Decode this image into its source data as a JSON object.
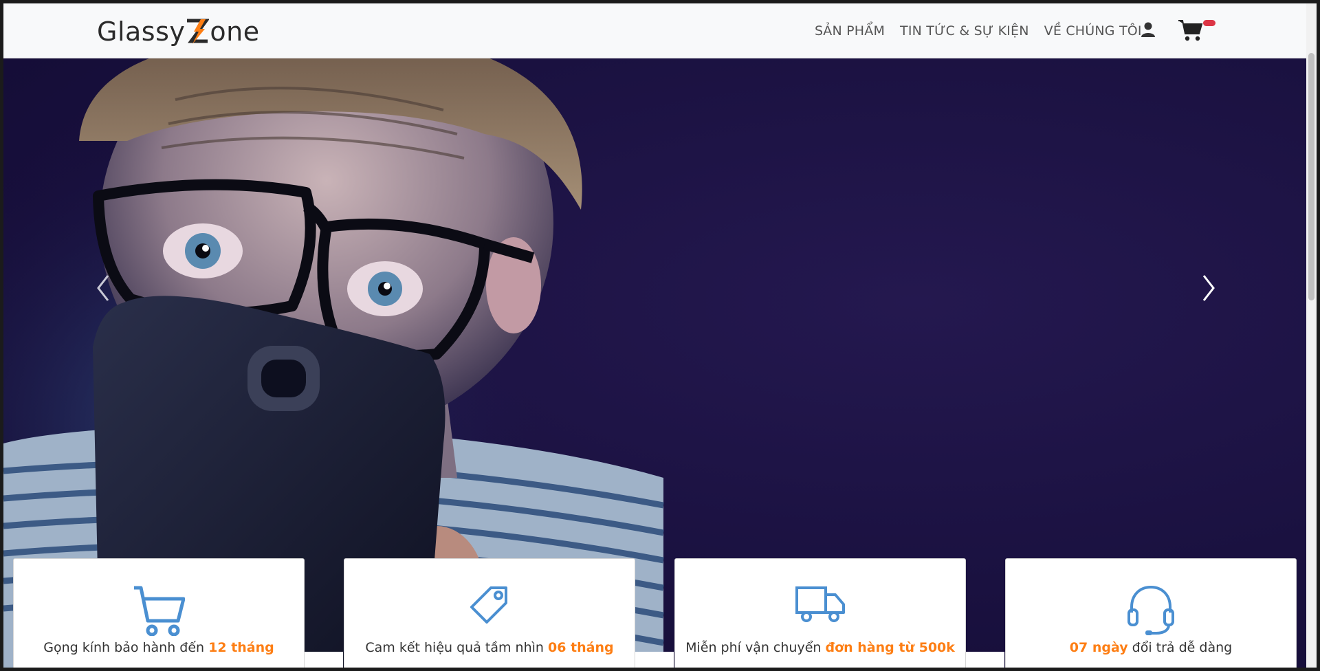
{
  "brand": {
    "logo_text_left": "Glassy",
    "logo_text_right": "one"
  },
  "nav": {
    "items": [
      "SẢN PHẨM",
      "TIN TỨC & SỰ KIỆN",
      "VỀ CHÚNG TÔI"
    ]
  },
  "header_icons": [
    "user-icon",
    "cart-icon"
  ],
  "colors": {
    "accent": "#fd7e14",
    "icon_blue": "#4a8fd1",
    "badge": "#dc3545",
    "hero_bg": "#1a1140"
  },
  "carousel": {
    "prev_icon": "chevron-left-icon",
    "next_icon": "chevron-right-icon"
  },
  "features": [
    {
      "icon": "cart-icon",
      "text": "Gọng kính bảo hành đến ",
      "highlight": "12 tháng",
      "highlight_first": false
    },
    {
      "icon": "tag-icon",
      "text": "Cam kết hiệu quả tầm nhìn ",
      "highlight": "06 tháng",
      "highlight_first": false
    },
    {
      "icon": "truck-icon",
      "text": "Miễn phí vận chuyển ",
      "highlight": "đơn hàng từ 500k",
      "highlight_first": false
    },
    {
      "icon": "headset-icon",
      "text": " đổi trả dễ dàng",
      "highlight": "07 ngày",
      "highlight_first": true
    }
  ]
}
